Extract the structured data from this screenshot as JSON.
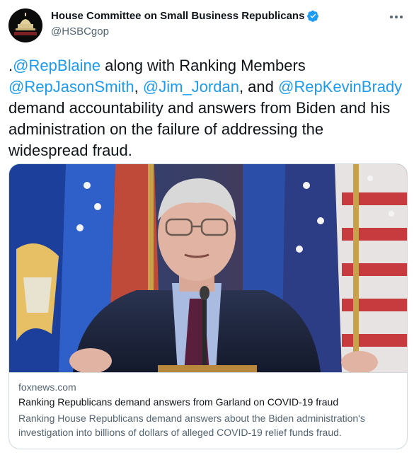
{
  "author": {
    "display_name": "House Committee on Small Business Republicans",
    "handle": "@HSBCgop",
    "avatar_text": "SMALL BUSINESS"
  },
  "tweet": {
    "t1": ".",
    "m1": "@RepBlaine",
    "t2": " along with Ranking Members ",
    "m2": "@RepJasonSmith",
    "t3": ", ",
    "m3": "@Jim_Jordan",
    "t4": ", and ",
    "m4": "@RepKevinBrady",
    "t5": " demand accountability and answers from Biden and his administration on the failure of addressing the widespread fraud."
  },
  "card": {
    "domain": "foxnews.com",
    "title": "Ranking Republicans demand answers from Garland on COVID-19 fraud",
    "description": "Ranking House Republicans demand answers about the Biden administration's investigation into billions of dollars of alleged COVID-19 relief funds fraud."
  },
  "colors": {
    "accent": "#1d9bf0",
    "text": "#0f1419",
    "secondary": "#536471",
    "border": "#cfd9de"
  },
  "icons": {
    "verified": "verified-badge-icon",
    "more": "more-horizontal-icon"
  }
}
